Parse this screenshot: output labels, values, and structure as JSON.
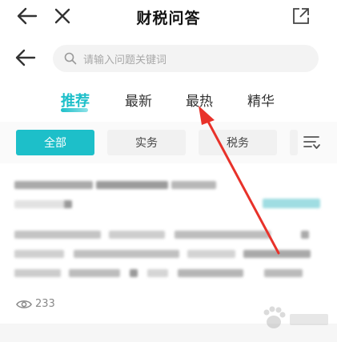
{
  "header": {
    "title": "财税问答"
  },
  "search": {
    "placeholder": "请输入问题关键词"
  },
  "tabs": [
    {
      "label": "推荐",
      "active": true
    },
    {
      "label": "最新",
      "active": false
    },
    {
      "label": "最热",
      "active": false
    },
    {
      "label": "精华",
      "active": false
    }
  ],
  "filters": [
    {
      "label": "全部",
      "active": true
    },
    {
      "label": "实务",
      "active": false
    },
    {
      "label": "税务",
      "active": false
    }
  ],
  "post": {
    "views": "233"
  },
  "colors": {
    "accent": "#1dbfc9",
    "arrow": "#e8322a"
  }
}
